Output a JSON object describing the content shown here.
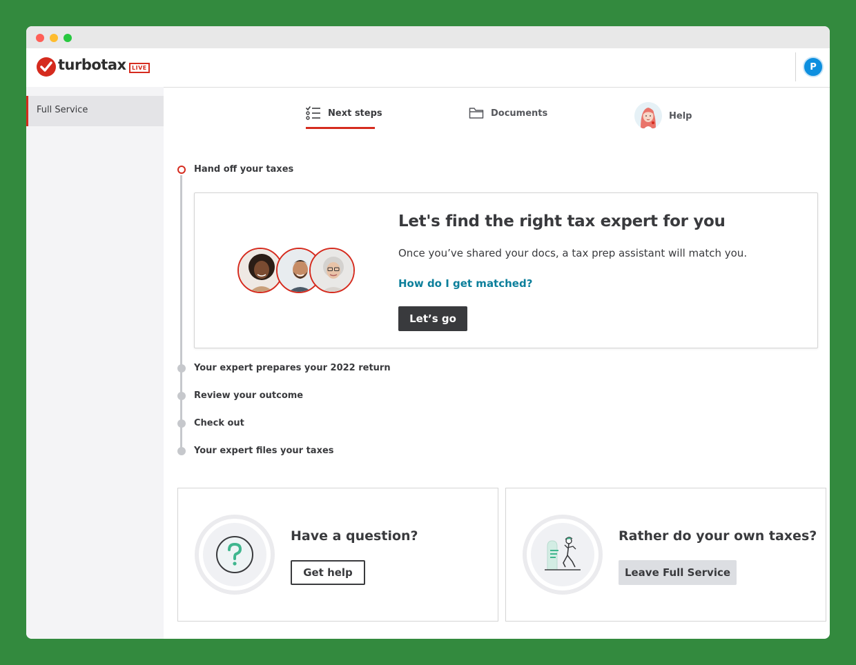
{
  "brand": {
    "name": "turbotax",
    "badge": "LIVE"
  },
  "sidebar": {
    "items": [
      {
        "label": "Full Service"
      }
    ]
  },
  "user": {
    "initial": "P"
  },
  "tabs": [
    {
      "label": "Next steps",
      "icon": "checklist-icon",
      "active": true
    },
    {
      "label": "Documents",
      "icon": "folder-icon"
    },
    {
      "label": "Help",
      "icon": "help-assistant-avatar"
    }
  ],
  "timeline": {
    "steps": [
      {
        "label": "Hand off your taxes",
        "active": true
      },
      {
        "label": "Your expert prepares your 2022 return"
      },
      {
        "label": "Review your outcome"
      },
      {
        "label": "Check out"
      },
      {
        "label": "Your expert files your taxes"
      }
    ]
  },
  "hero": {
    "title": "Let's find the right tax expert for you",
    "subtitle": "Once you’ve shared your docs, a tax prep assistant will match you.",
    "link": "How do I get matched?",
    "button": "Let’s go"
  },
  "cards": [
    {
      "title": "Have a question?",
      "button": "Get help",
      "icon": "question-icon"
    },
    {
      "title": "Rather do your own taxes?",
      "button": "Leave Full Service",
      "icon": "person-leaving-icon"
    }
  ],
  "colors": {
    "brand_red": "#d52b1e",
    "link_teal": "#0c7f9b",
    "avatar_blue": "#0d8fdf",
    "background_green": "#338a3e"
  }
}
